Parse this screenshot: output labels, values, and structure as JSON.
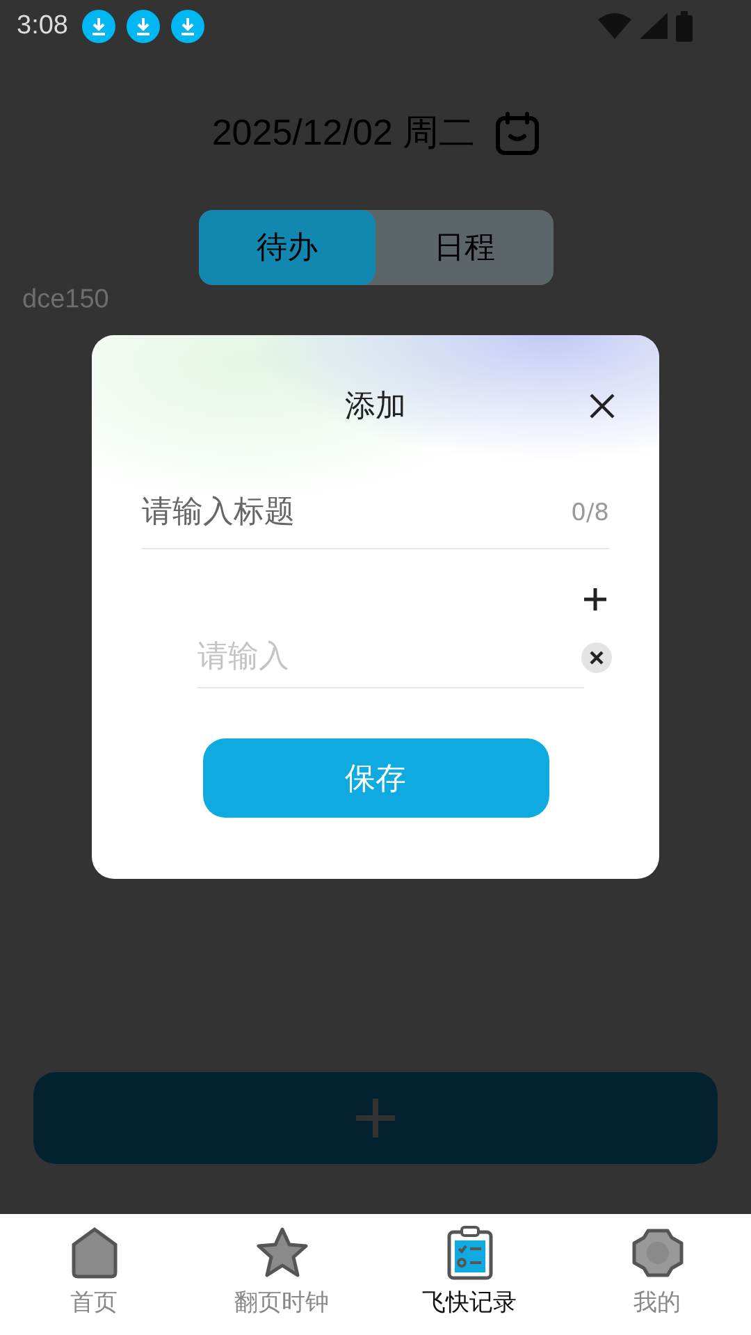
{
  "status_bar": {
    "time": "3:08",
    "notifications": [
      {
        "kind": "download"
      },
      {
        "kind": "download"
      },
      {
        "kind": "download"
      }
    ]
  },
  "header": {
    "date": "2025/12/02 周二"
  },
  "tabs": [
    {
      "label": "待办",
      "selected": true
    },
    {
      "label": "日程",
      "selected": false
    }
  ],
  "user_code": "dce150",
  "dialog": {
    "title": "添加",
    "title_field": {
      "placeholder": "请输入标题",
      "counter": "0/8"
    },
    "items": [
      {
        "placeholder": "请输入"
      }
    ],
    "save_button": "保存"
  },
  "bottom_nav": [
    {
      "label": "首页",
      "kind": "home",
      "selected": false
    },
    {
      "label": "翻页时钟",
      "kind": "clock",
      "selected": false
    },
    {
      "label": "飞快记录",
      "kind": "notes",
      "selected": true
    },
    {
      "label": "我的",
      "kind": "profile",
      "selected": false
    }
  ]
}
